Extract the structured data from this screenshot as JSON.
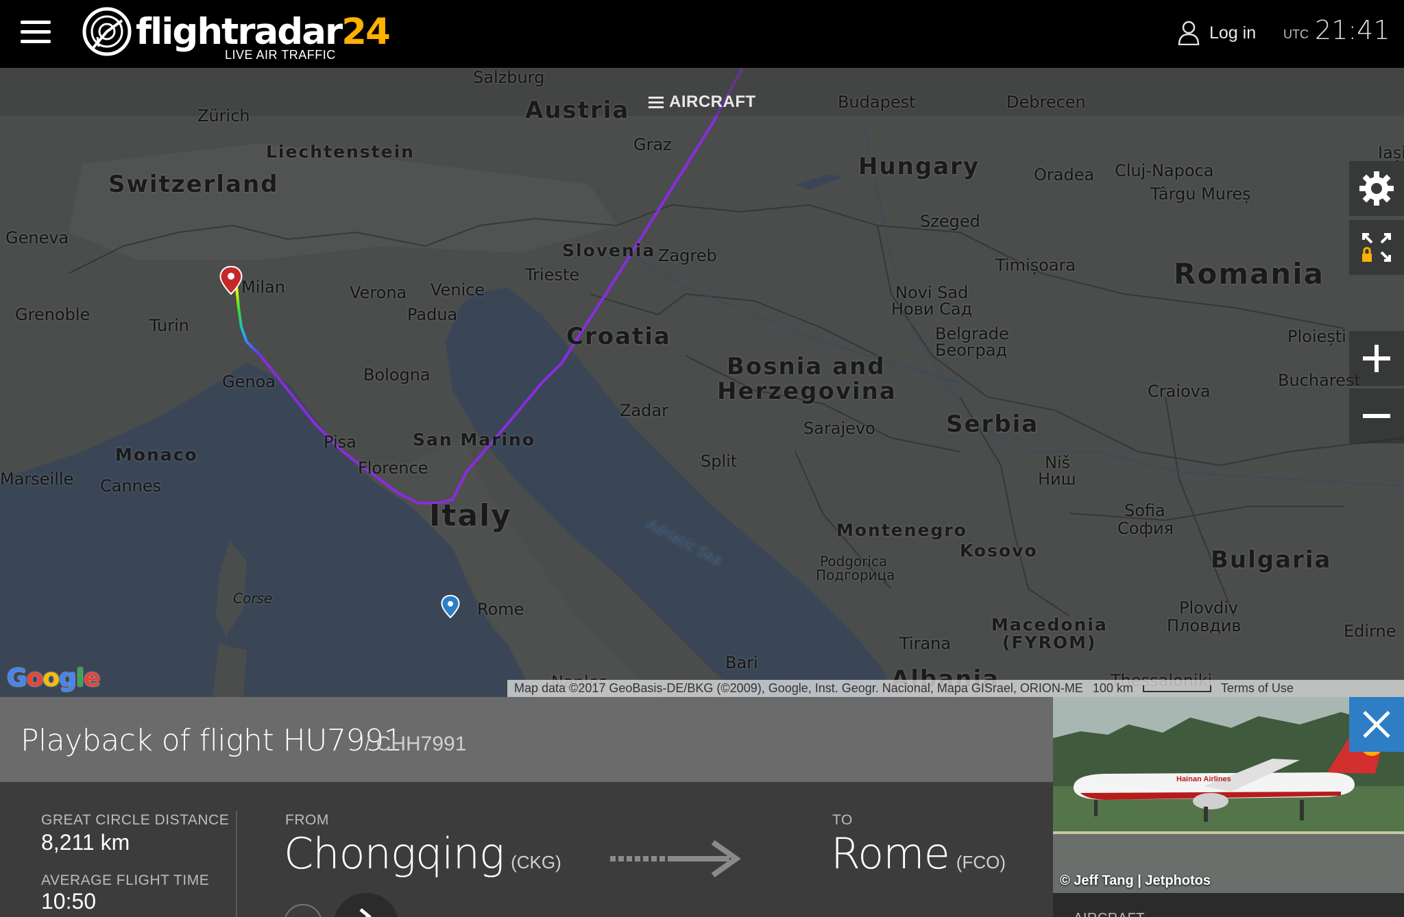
{
  "header": {
    "logo_text": "flightradar",
    "logo_number": "24",
    "logo_subtitle": "LIVE AIR TRAFFIC",
    "login_label": "Log in",
    "utc_label": "UTC",
    "utc_time": "21:41",
    "accent_color": "#ffb000"
  },
  "map": {
    "aircraft_button_label": "AIRCRAFT",
    "countries": [
      "Austria",
      "Switzerland",
      "Liechtenstein",
      "Hungary",
      "Romania",
      "Slovenia",
      "Croatia",
      "Bosnia and",
      "Herzegovina",
      "Serbia",
      "San Marino",
      "Italy",
      "Monaco",
      "Montenegro",
      "Kosovo",
      "Bulgaria",
      "Macedonia",
      "(FYROM)",
      "Albania"
    ],
    "cities": [
      "Salzburg",
      "Zürich",
      "Budapest",
      "Debrecen",
      "Graz",
      "Oradea",
      "Cluj-Napoca",
      "Târgu Mureș",
      "Iași",
      "Geneva",
      "Szeged",
      "Timișoara",
      "Trieste",
      "Zagreb",
      "Milan",
      "Verona",
      "Venice",
      "Padua",
      "Turin",
      "Grenoble",
      "Novi Sad",
      "Нови Сад",
      "Belgrade",
      "Београд",
      "Ploiești",
      "Genoa",
      "Bologna",
      "Bucharest",
      "Craiova",
      "Zadar",
      "Sarajevo",
      "Pisa",
      "Florence",
      "Split",
      "Niš",
      "Ниш",
      "Marseille",
      "Cannes",
      "Sofia",
      "София",
      "Corse",
      "Podgorica",
      "Подгорица",
      "Rome",
      "Plovdiv",
      "Пловдив",
      "Edirne",
      "Tirana",
      "Bari",
      "Naples",
      "Thessaloniki"
    ],
    "sea_label": "Adriatic Sea",
    "attribution": "Map data ©2017 GeoBasis-DE/BKG (©2009), Google, Inst. Geogr. Nacional, Mapa GISrael, ORION-ME",
    "scale_label": "100 km",
    "terms_label": "Terms of Use",
    "google_letters": [
      "G",
      "o",
      "o",
      "g",
      "l",
      "e"
    ],
    "google_colors": [
      "#4285f4",
      "#ea4335",
      "#fbbc05",
      "#4285f4",
      "#34a853",
      "#ea4335"
    ],
    "track_color": "#8a2be2",
    "controls": [
      "settings-icon",
      "fullscreen-lock-icon",
      "zoom-in-icon",
      "zoom-out-icon"
    ]
  },
  "playback": {
    "title": "Playback of flight HU7991",
    "callsign": "/ CHH7991",
    "distance_label": "GREAT CIRCLE DISTANCE",
    "distance_value": "8,211 km",
    "avg_time_label": "AVERAGE FLIGHT TIME",
    "avg_time_value": "10:50",
    "from_label": "FROM",
    "from_city": "Chongqing",
    "from_code": "(CKG)",
    "to_label": "TO",
    "to_city": "Rome",
    "to_code": "(FCO)"
  },
  "photo": {
    "credit": "© Jeff Tang | Jetphotos",
    "airline_text": "Hainan Airlines",
    "aircraft_section_label": "AIRCRAFT"
  }
}
